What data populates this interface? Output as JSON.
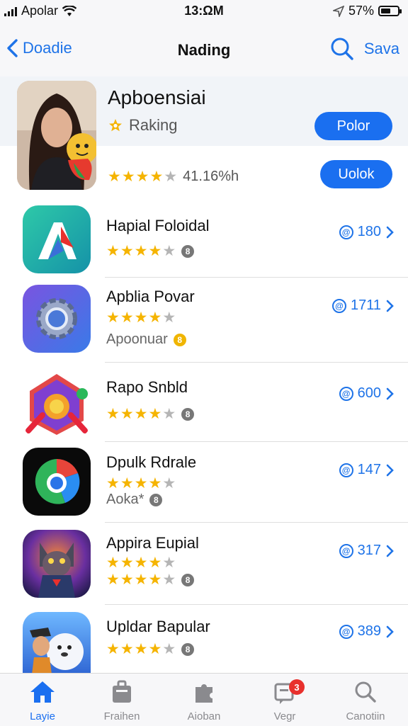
{
  "status_bar": {
    "carrier": "Apolar",
    "time": "13:ΩM",
    "battery": "57%",
    "battery_level": 0.57
  },
  "nav": {
    "back_label": "Doadie",
    "title": "Nading",
    "right_label": "Sava"
  },
  "featured": {
    "title": "Apboensiai",
    "subtitle": "Raking",
    "rating_text": "41.16%h",
    "stars": 4,
    "button_primary": "Polor",
    "button_secondary": "Uolok"
  },
  "apps": [
    {
      "name": "Hapial Foloidal",
      "stars": 4,
      "extra": "",
      "badge": "8",
      "price": "180"
    },
    {
      "name": "Apblia Povar",
      "stars": 4,
      "extra": "Apoonuar",
      "badge": "8",
      "price": "1711"
    },
    {
      "name": "Rapo Snbld",
      "stars": 4,
      "extra": "",
      "badge": "8",
      "price": "600"
    },
    {
      "name": "Dpulk Rdrale",
      "stars": 4,
      "extra": "Aoka*",
      "badge": "8",
      "price": "147"
    },
    {
      "name": "Appira Eupial",
      "stars": 4,
      "extra": "",
      "badge": "8",
      "price": "317"
    },
    {
      "name": "Upldar Bapular",
      "stars": 4,
      "extra": "",
      "badge": "8",
      "price": "389"
    }
  ],
  "tabs": [
    {
      "label": "Layie",
      "icon": "home-icon",
      "active": true
    },
    {
      "label": "Fraihen",
      "icon": "store-icon"
    },
    {
      "label": "Aioban",
      "icon": "puzzle-icon"
    },
    {
      "label": "Vegr",
      "icon": "updates-icon",
      "badge": "3"
    },
    {
      "label": "Canotiin",
      "icon": "search-icon"
    }
  ],
  "colors": {
    "accent": "#1a6ff0",
    "star": "#f5b400",
    "badge": "#e8302d"
  }
}
